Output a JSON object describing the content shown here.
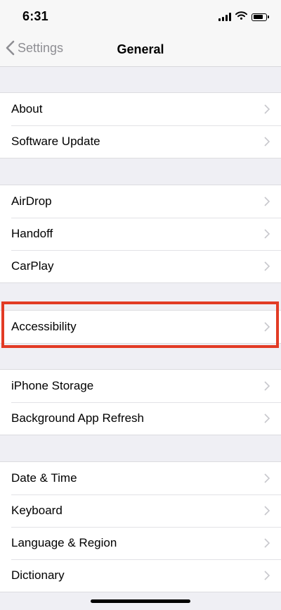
{
  "status_bar": {
    "time": "6:31",
    "battery_level": 0.85
  },
  "navbar": {
    "back_label": "Settings",
    "title": "General"
  },
  "groups": [
    {
      "items": [
        {
          "label": "About"
        },
        {
          "label": "Software Update"
        }
      ]
    },
    {
      "items": [
        {
          "label": "AirDrop"
        },
        {
          "label": "Handoff"
        },
        {
          "label": "CarPlay"
        }
      ]
    },
    {
      "items": [
        {
          "label": "Accessibility",
          "highlighted": true
        }
      ]
    },
    {
      "items": [
        {
          "label": "iPhone Storage"
        },
        {
          "label": "Background App Refresh"
        }
      ]
    },
    {
      "items": [
        {
          "label": "Date & Time"
        },
        {
          "label": "Keyboard"
        },
        {
          "label": "Language & Region"
        },
        {
          "label": "Dictionary"
        }
      ]
    }
  ],
  "colors": {
    "background": "#efeff4",
    "highlight_border": "#e23b25",
    "chevron": "#c7c7cc",
    "back_text": "#8e8e93"
  },
  "icons": {
    "back": "chevron-left-icon",
    "row_disclosure": "chevron-right-icon",
    "signal": "cellular-signal-icon",
    "wifi": "wifi-icon",
    "battery": "battery-icon"
  }
}
